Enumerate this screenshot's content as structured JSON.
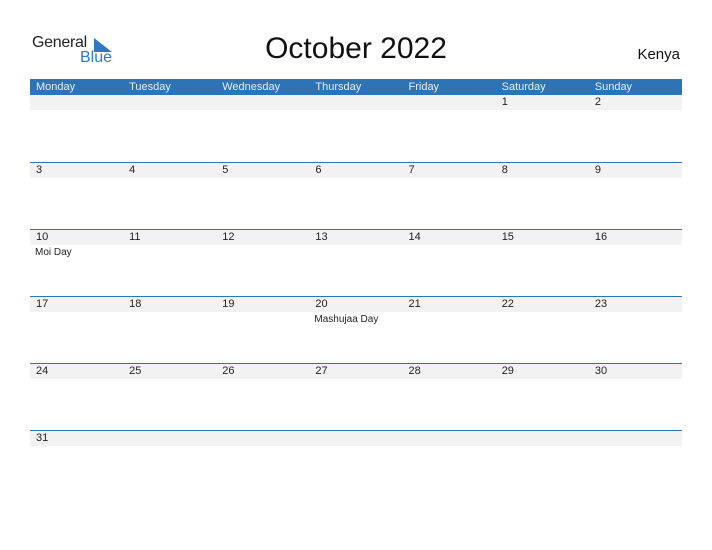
{
  "logo": {
    "part1": "General",
    "part2": "Blue",
    "icon": "triangle-flag-icon"
  },
  "title": "October 2022",
  "country": "Kenya",
  "weekdays": [
    "Monday",
    "Tuesday",
    "Wednesday",
    "Thursday",
    "Friday",
    "Saturday",
    "Sunday"
  ],
  "weeks": [
    [
      {
        "day": ""
      },
      {
        "day": ""
      },
      {
        "day": ""
      },
      {
        "day": ""
      },
      {
        "day": ""
      },
      {
        "day": "1"
      },
      {
        "day": "2"
      }
    ],
    [
      {
        "day": "3"
      },
      {
        "day": "4"
      },
      {
        "day": "5"
      },
      {
        "day": "6"
      },
      {
        "day": "7"
      },
      {
        "day": "8"
      },
      {
        "day": "9"
      }
    ],
    [
      {
        "day": "10",
        "holiday": "Moi Day"
      },
      {
        "day": "11"
      },
      {
        "day": "12"
      },
      {
        "day": "13"
      },
      {
        "day": "14"
      },
      {
        "day": "15"
      },
      {
        "day": "16"
      }
    ],
    [
      {
        "day": "17"
      },
      {
        "day": "18"
      },
      {
        "day": "19"
      },
      {
        "day": "20",
        "holiday": "Mashujaa Day"
      },
      {
        "day": "21"
      },
      {
        "day": "22"
      },
      {
        "day": "23"
      }
    ],
    [
      {
        "day": "24"
      },
      {
        "day": "25"
      },
      {
        "day": "26"
      },
      {
        "day": "27"
      },
      {
        "day": "28"
      },
      {
        "day": "29"
      },
      {
        "day": "30"
      }
    ],
    [
      {
        "day": "31"
      },
      {
        "day": ""
      },
      {
        "day": ""
      },
      {
        "day": ""
      },
      {
        "day": ""
      },
      {
        "day": ""
      },
      {
        "day": ""
      }
    ]
  ],
  "colors": {
    "header": "#2e74b5",
    "band": "#f2f2f2",
    "brand_blue": "#2f79c2"
  }
}
